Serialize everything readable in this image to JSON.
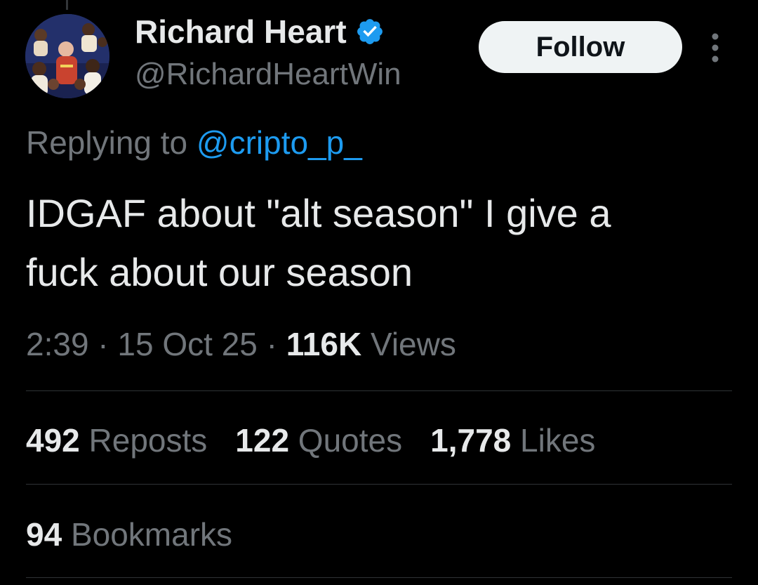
{
  "author": {
    "display_name": "Richard Heart",
    "handle": "@RichardHeartWin",
    "verified_icon": "verified-badge-icon",
    "avatar_icon": "avatar-group-photo"
  },
  "follow_label": "Follow",
  "more_icon": "more-vertical-icon",
  "reply": {
    "prefix": "Replying to ",
    "handle": "@cripto_p_"
  },
  "tweet": {
    "text": "IDGAF about \"alt season\" I give a\nfuck about our season"
  },
  "meta": {
    "time": "2:39",
    "sep1": " · ",
    "date": "15 Oct 25",
    "sep2": " · ",
    "views_count": "116K",
    "views_label": " Views"
  },
  "stats": {
    "reposts_count": "492",
    "reposts_label": " Reposts",
    "quotes_count": "122",
    "quotes_label": " Quotes",
    "likes_count": "1,778",
    "likes_label": " Likes",
    "bookmarks_count": "94",
    "bookmarks_label": " Bookmarks"
  },
  "colors": {
    "background": "#000000",
    "primary_text": "#e7e9ea",
    "secondary_text": "#71767b",
    "link": "#1d9bf0",
    "divider": "#2f3336",
    "follow_bg": "#eff3f4"
  }
}
